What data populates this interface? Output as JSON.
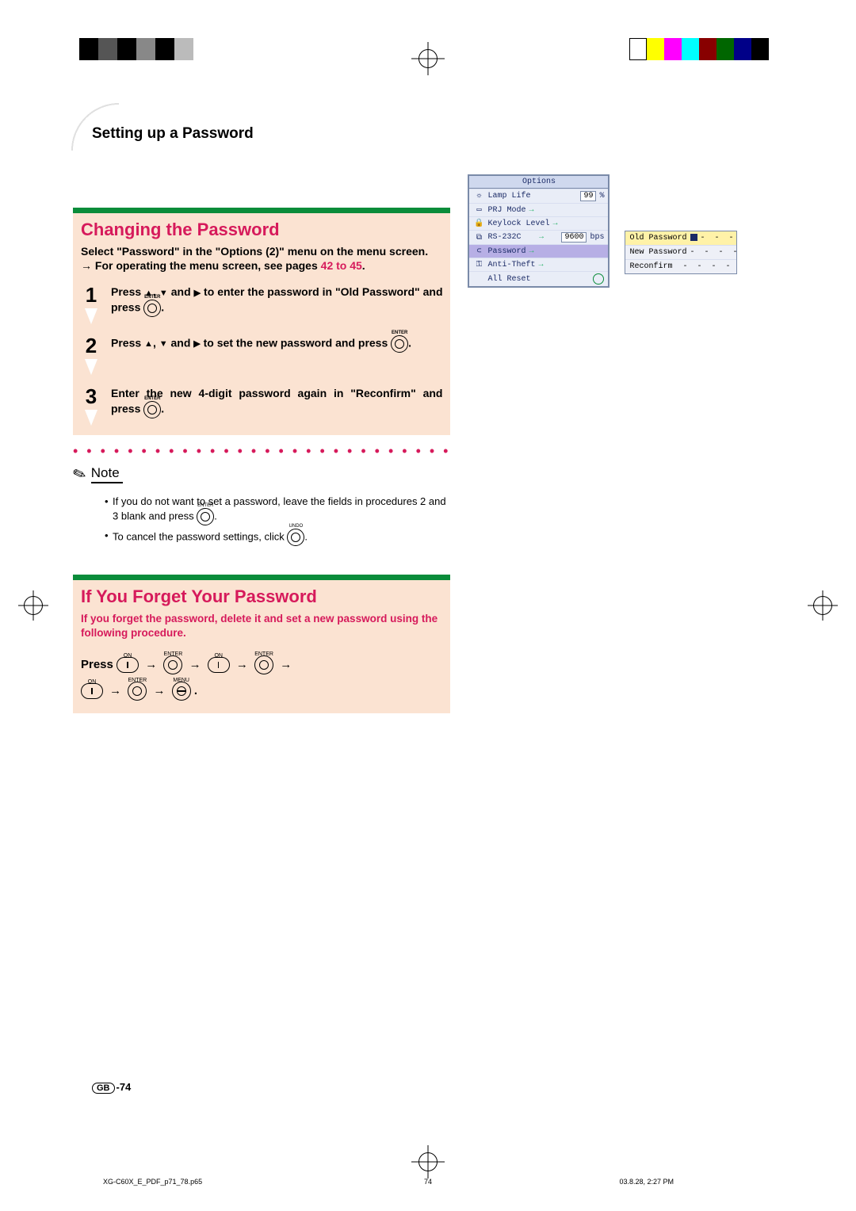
{
  "header": {
    "section_title": "Setting up a Password"
  },
  "section1": {
    "title": "Changing the Password",
    "intro_line1": "Select \"Password\" in the \"Options (2)\" menu on the menu screen.",
    "intro_line2_pre": "For operating the menu screen, see pages ",
    "intro_link": "42 to 45",
    "intro_line2_post": ".",
    "steps": [
      {
        "num": "1",
        "text_a": "Press ",
        "text_b": ", ",
        "text_c": " and ",
        "text_d": " to enter the password in \"Old Password\" and press ",
        "text_e": "."
      },
      {
        "num": "2",
        "text_a": "Press ",
        "text_b": ", ",
        "text_c": " and ",
        "text_d": " to set the new password and press ",
        "text_e": "."
      },
      {
        "num": "3",
        "text_a": "Enter the new 4-digit password again in \"Reconfirm\" and press ",
        "text_e": "."
      }
    ],
    "dots": "• • • • • • • • • • • • • • • • • • • • • • • • • • • •",
    "note_label": "Note",
    "note1_a": "If you do not want to set a password, leave the fields in procedures 2 and 3 blank and press ",
    "note1_b": ".",
    "note2_a": "To cancel the password settings, click ",
    "note2_b": "."
  },
  "section2": {
    "title": "If You Forget Your Password",
    "intro": "If you forget the password, delete it and set a new password using the following procedure.",
    "press_label": "Press ",
    "btn_on": "ON",
    "btn_enter": "ENTER",
    "btn_menu": "MENU",
    "arrow": "→",
    "period": "."
  },
  "osd": {
    "title": "Options",
    "rows": [
      {
        "icon": "☼",
        "label": "Lamp Life",
        "value": "99",
        "unit": "%"
      },
      {
        "icon": "▭",
        "label": "PRJ Mode"
      },
      {
        "icon": "🔒",
        "label": "Keylock Level"
      },
      {
        "icon": "⧉",
        "label": "RS-232C",
        "value": "9600",
        "unit": "bps"
      },
      {
        "icon": "⊂",
        "label": "Password",
        "selected": true
      },
      {
        "icon": "⚿",
        "label": "Anti-Theft"
      },
      {
        "icon": "",
        "label": "All Reset",
        "reset": true
      }
    ]
  },
  "pw_panel": {
    "rows": [
      {
        "label": "Old Password",
        "sel": true,
        "cursor": true,
        "dash": "-  -  -"
      },
      {
        "label": "New Password",
        "dash": "-  -  -  -"
      },
      {
        "label": "Reconfirm",
        "dash": "-  -  -  -"
      }
    ]
  },
  "footer": {
    "gb": "GB",
    "page": "-74",
    "file": "XG-C60X_E_PDF_p71_78.p65",
    "pn": "74",
    "date": "03.8.28, 2:27 PM"
  }
}
